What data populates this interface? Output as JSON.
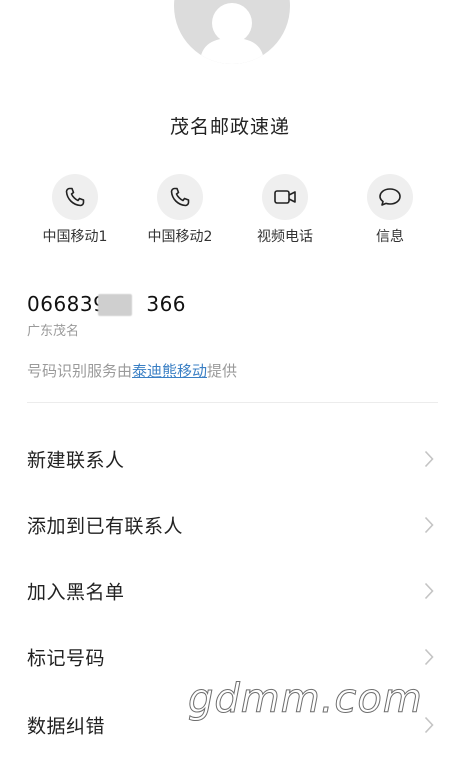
{
  "contact": {
    "name": "茂名邮政速递"
  },
  "actions": [
    {
      "label": "中国移动1",
      "icon": "phone-icon"
    },
    {
      "label": "中国移动2",
      "icon": "phone-icon"
    },
    {
      "label": "视频电话",
      "icon": "video-call-icon"
    },
    {
      "label": "信息",
      "icon": "message-icon"
    }
  ],
  "number": {
    "display_prefix": "066839",
    "display_suffix": "366",
    "location": "广东茂名"
  },
  "service": {
    "prefix": "号码识别服务由",
    "provider": "泰迪熊移动",
    "suffix": "提供"
  },
  "menu": {
    "items": [
      {
        "label": "新建联系人"
      },
      {
        "label": "添加到已有联系人"
      },
      {
        "label": "加入黑名单"
      },
      {
        "label": "标记号码"
      },
      {
        "label": "数据纠错"
      }
    ]
  },
  "watermark": "gdmm.com",
  "colors": {
    "link": "#3a7fc4",
    "avatar_bg": "#dcdcdc",
    "action_bg": "#efefef",
    "secondary_text": "#9a9a9a"
  }
}
